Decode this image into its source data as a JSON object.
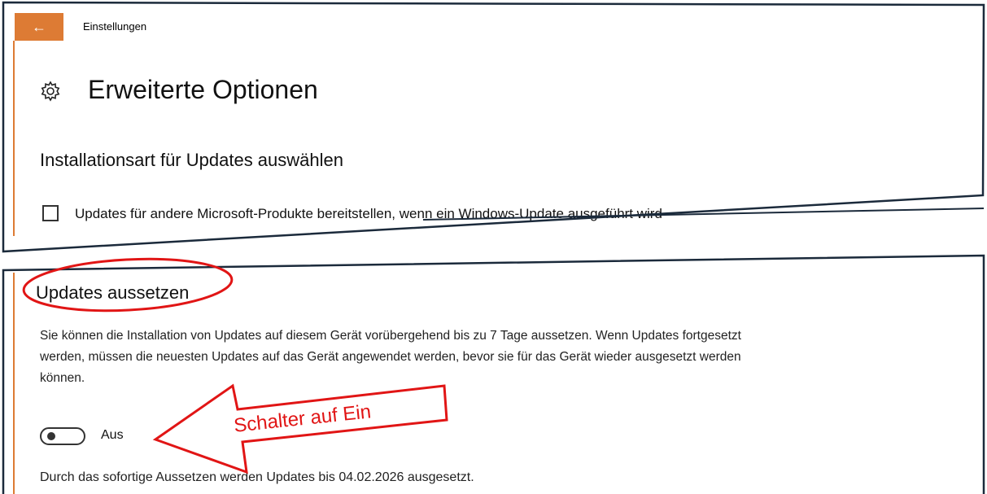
{
  "window": {
    "title": "Einstellungen",
    "back_icon": "arrow-left-icon",
    "accent_color": "#dd7b34"
  },
  "page": {
    "title": "Erweiterte Optionen",
    "title_icon": "gear-icon"
  },
  "install_section": {
    "heading": "Installationsart für Updates auswählen",
    "checkbox_label": "Updates für andere Microsoft-Produkte bereitstellen, wenn ein Windows-Update ausgeführt wird",
    "checkbox_checked": false
  },
  "pause_section": {
    "heading": "Updates aussetzen",
    "description": "Sie können die Installation von Updates auf diesem Gerät vorübergehend bis zu 7 Tage aussetzen. Wenn Updates fortgesetzt werden, müssen die neuesten Updates auf das Gerät angewendet werden, bevor sie für das Gerät wieder ausgesetzt werden können.",
    "toggle_state": "off",
    "toggle_label": "Aus",
    "info_text": "Durch das sofortige Aussetzen werden Updates bis 04.02.2026 ausgesetzt."
  },
  "annotation": {
    "callout_text": "Schalter auf Ein",
    "color": "#e11515"
  }
}
